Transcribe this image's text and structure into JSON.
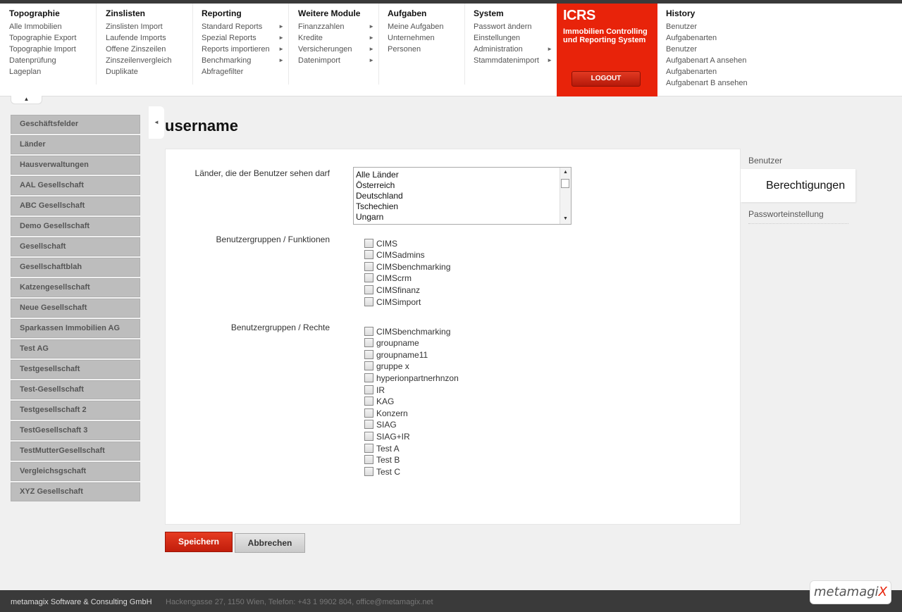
{
  "nav": {
    "columns": [
      {
        "title": "Topographie",
        "items": [
          {
            "label": "Alle Immobilien"
          },
          {
            "label": "Topographie Export"
          },
          {
            "label": "Topographie Import"
          },
          {
            "label": "Datenprüfung"
          },
          {
            "label": "Lageplan"
          }
        ]
      },
      {
        "title": "Zinslisten",
        "items": [
          {
            "label": "Zinslisten Import"
          },
          {
            "label": "Laufende Imports"
          },
          {
            "label": "Offene Zinszeilen"
          },
          {
            "label": "Zinszeilenvergleich"
          },
          {
            "label": "Duplikate"
          }
        ]
      },
      {
        "title": "Reporting",
        "items": [
          {
            "label": "Standard Reports",
            "arrow": "►"
          },
          {
            "label": "Spezial Reports",
            "arrow": "►"
          },
          {
            "label": "Reports importieren",
            "arrow": "►"
          },
          {
            "label": "Benchmarking",
            "arrow": "►"
          },
          {
            "label": "Abfragefilter"
          }
        ]
      },
      {
        "title": "Weitere Module",
        "items": [
          {
            "label": "Finanzzahlen",
            "arrow": "►"
          },
          {
            "label": "Kredite",
            "arrow": "►"
          },
          {
            "label": "Versicherungen",
            "arrow": "►"
          },
          {
            "label": "Datenimport",
            "arrow": "►"
          }
        ]
      },
      {
        "title": "Aufgaben",
        "items": [
          {
            "label": "Meine Aufgaben"
          },
          {
            "label": "Unternehmen"
          },
          {
            "label": "Personen"
          }
        ]
      },
      {
        "title": "System",
        "items": [
          {
            "label": "Passwort ändern"
          },
          {
            "label": "Einstellungen"
          },
          {
            "label": "Administration",
            "arrow": "►"
          },
          {
            "label": "Stammdatenimport",
            "arrow": "►"
          }
        ]
      }
    ],
    "brand": {
      "logo": "ICRS",
      "tagline_1": "Immobilien Controlling",
      "tagline_2": "und Reporting System",
      "logout": "LOGOUT"
    },
    "history": {
      "title": "History",
      "items": [
        "Benutzer",
        "Aufgabenarten",
        "Benutzer",
        "Aufgabenart A ansehen",
        "Aufgabenarten",
        "Aufgabenart B ansehen"
      ]
    }
  },
  "sidebar": {
    "items": [
      "Geschäftsfelder",
      "Länder",
      "Hausverwaltungen",
      "AAL Gesellschaft",
      "ABC Gesellschaft",
      "Demo Gesellschaft",
      "Gesellschaft",
      "Gesellschaftblah",
      "Katzengesellschaft",
      "Neue Gesellschaft",
      "Sparkassen Immobilien AG",
      "Test AG",
      "Testgesellschaft",
      "Test-Gesellschaft",
      "Testgesellschaft 2",
      "TestGesellschaft 3",
      "TestMutterGesellschaft",
      "Vergleichsgschaft",
      "XYZ Gesellschaft"
    ]
  },
  "main": {
    "title": "username",
    "countries_label": "Länder, die der Benutzer sehen darf",
    "countries": [
      "Alle Länder",
      "Österreich",
      "Deutschland",
      "Tschechien",
      "Ungarn"
    ],
    "functions_label": "Benutzergruppen / Funktionen",
    "functions": [
      "CIMS",
      "CIMSadmins",
      "CIMSbenchmarking",
      "CIMScrm",
      "CIMSfinanz",
      "CIMSimport"
    ],
    "rights_label": "Benutzergruppen / Rechte",
    "rights": [
      "CIMSbenchmarking",
      "groupname",
      "groupname11",
      "gruppe x",
      "hyperionpartnerhnzon",
      "IR",
      "KAG",
      "Konzern",
      "SIAG",
      "SIAG+IR",
      "Test A",
      "Test B",
      "Test C"
    ]
  },
  "tabs": {
    "benutzer": "Benutzer",
    "berechtigungen": "Berechtigungen",
    "passwort": "Passworteinstellung"
  },
  "buttons": {
    "save": "Speichern",
    "cancel": "Abbrechen"
  },
  "footer": {
    "company": "metamagix Software & Consulting GmbH",
    "address": "Hackengasse 27, 1150 Wien, Telefon: +43 1 9902 804, office@metamagix.net",
    "logo_main": "metamagi",
    "logo_accent": "X"
  },
  "colors": {
    "brand_red": "#e8230a",
    "sidebar_gray": "#bdbdbd",
    "footer_dark": "#3a3a3a"
  },
  "icons": {
    "collapse_up": "▲",
    "sidebar_toggle": "◄",
    "scroll_up": "▲",
    "scroll_down": "▼"
  }
}
